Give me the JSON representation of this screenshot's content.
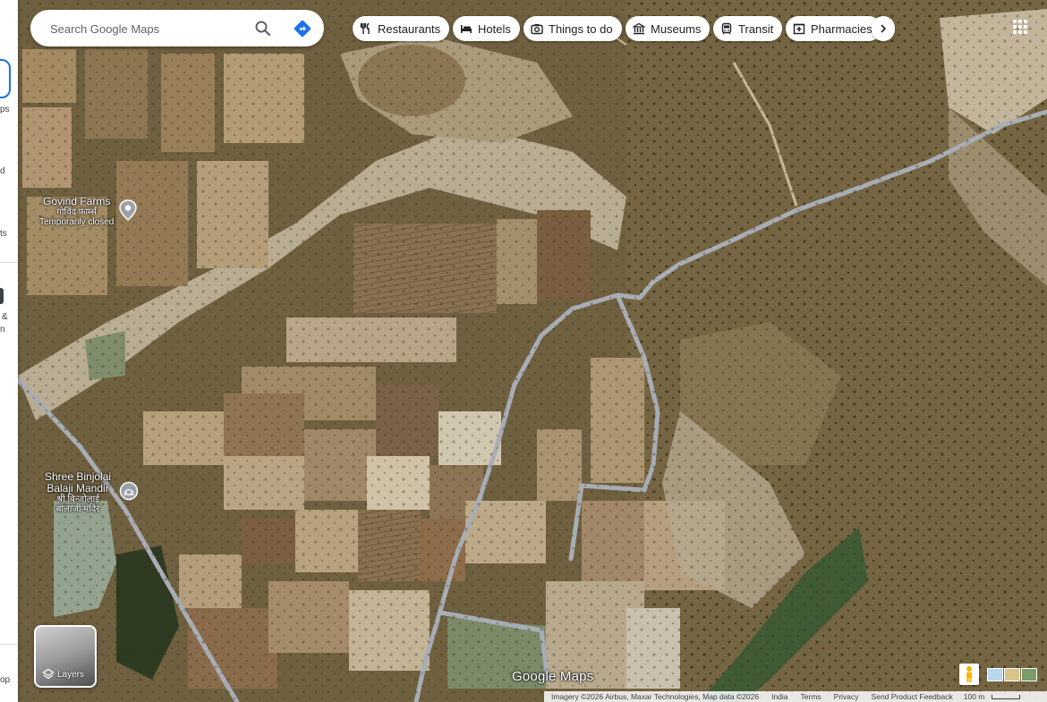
{
  "search": {
    "placeholder": "Search Google Maps"
  },
  "rail": {
    "fragments": [
      "ps",
      "d",
      "ts",
      "&",
      "n",
      "op"
    ]
  },
  "chips": [
    {
      "label": "Restaurants",
      "icon": "restaurant-icon"
    },
    {
      "label": "Hotels",
      "icon": "hotel-icon"
    },
    {
      "label": "Things to do",
      "icon": "camera-icon"
    },
    {
      "label": "Museums",
      "icon": "museum-icon"
    },
    {
      "label": "Transit",
      "icon": "transit-icon"
    },
    {
      "label": "Pharmacies",
      "icon": "pharmacy-icon"
    }
  ],
  "places": [
    {
      "name": "Govind Farms",
      "native": "गोविंद फार्म्स",
      "status": "Temporarily closed"
    },
    {
      "name_line1": "Shree Binjolai",
      "name_line2": "Balaji Mandir",
      "native_line1": "श्री बिन्जोलाई",
      "native_line2": "बालाजी मंदिर"
    }
  ],
  "layers": {
    "label": "Layers"
  },
  "logo": {
    "text": "Google Maps"
  },
  "footer": {
    "imagery": "Imagery ©2026 Airbus, Maxar Technologies, Map data ©2026",
    "country": "India",
    "terms": "Terms",
    "privacy": "Privacy",
    "feedback": "Send Product Feedback",
    "scale": "100 m"
  },
  "colors": {
    "accent": "#1a73e8",
    "road": "#a8adb5"
  }
}
